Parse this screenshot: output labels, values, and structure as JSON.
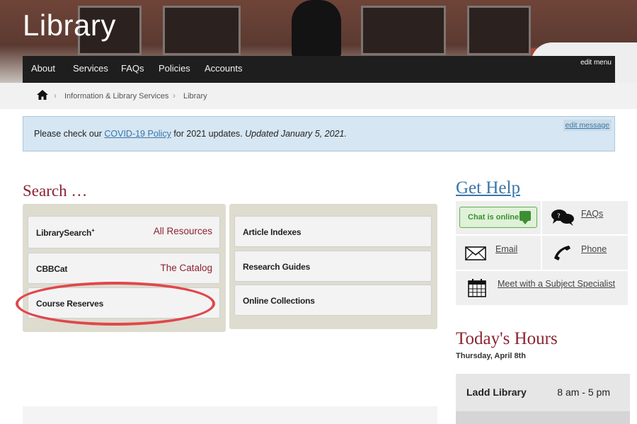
{
  "header": {
    "site_title": "Library",
    "edit_menu": "edit menu",
    "nav": [
      "About",
      "Services",
      "FAQs",
      "Policies",
      "Accounts"
    ]
  },
  "breadcrumb": {
    "items": [
      "Information & Library Services",
      "Library"
    ]
  },
  "notice": {
    "prefix": "Please check our ",
    "link": "COVID-19 Policy",
    "middle": " for 2021 updates. ",
    "updated": "Updated January 5, 2021.",
    "edit_message": "edit message"
  },
  "search": {
    "heading": "Search …",
    "left": [
      {
        "label": "LibrarySearch",
        "sup": "+",
        "tag": "All Resources"
      },
      {
        "label": "CBBCat",
        "sup": "",
        "tag": "The Catalog"
      },
      {
        "label": "Course Reserves",
        "sup": "",
        "tag": ""
      }
    ],
    "right": [
      {
        "label": "Article Indexes"
      },
      {
        "label": "Research Guides"
      },
      {
        "label": "Online Collections"
      }
    ]
  },
  "help": {
    "heading": "Get Help",
    "chat_label": "Chat is online",
    "faqs": "FAQs",
    "email": "Email",
    "phone": "Phone",
    "meet": "Meet with a Subject Specialist"
  },
  "hours": {
    "heading": "Today's Hours",
    "date": "Thursday, April 8th",
    "location": "Ladd Library",
    "time": "8 am - 5 pm"
  },
  "colors": {
    "accent_red": "#8b2332",
    "link_blue": "#3a76a8",
    "highlight": "#e0474c",
    "chat_green": "#3c8f33"
  }
}
